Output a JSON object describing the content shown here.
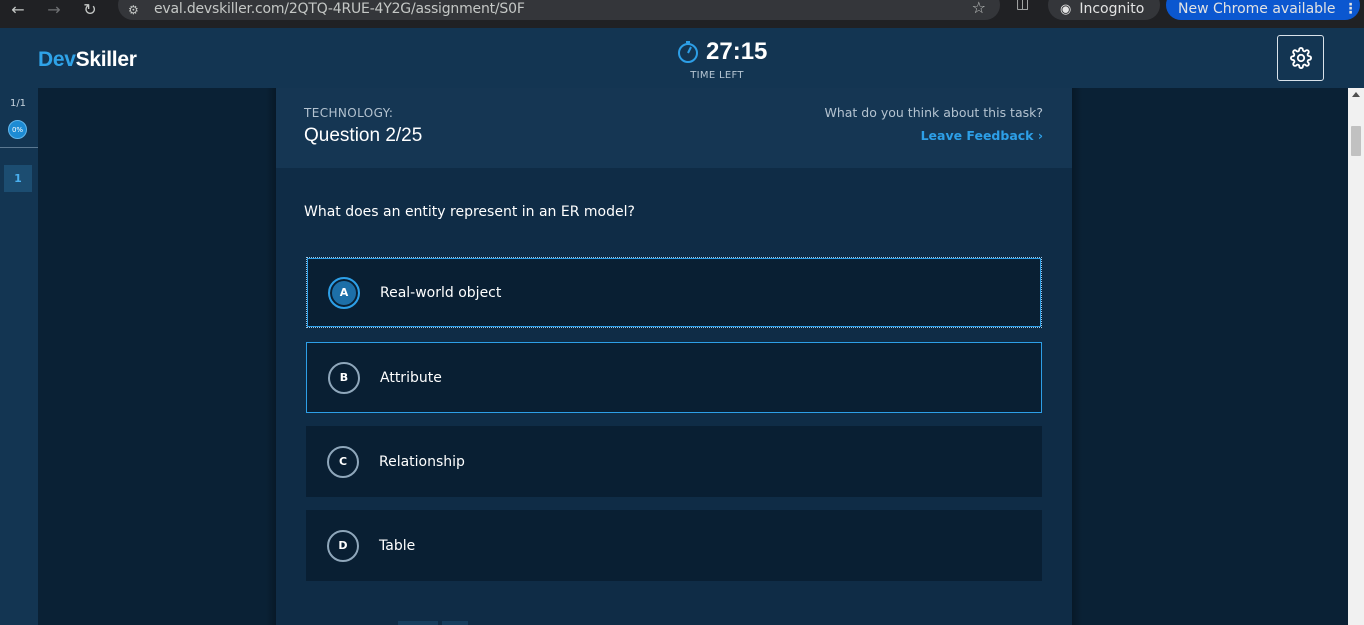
{
  "browser": {
    "url": "eval.devskiller.com/2QTQ-4RUE-4Y2G/assignment/S0F",
    "incognito_label": "Incognito",
    "update_label": "New Chrome available"
  },
  "header": {
    "logo_dev": "Dev",
    "logo_skiller": "Skiller",
    "timer_value": "27:15",
    "timer_label": "TIME LEFT"
  },
  "sidebar": {
    "task_count": "1/1",
    "progress": "0%",
    "task_number": "1"
  },
  "task": {
    "technology_label": "TECHNOLOGY:",
    "question_number": "Question 2/25",
    "feedback_prompt": "What do you think about this task?",
    "feedback_link": "Leave Feedback",
    "question_text": "What does an entity represent in an ER model?",
    "options": [
      {
        "letter": "A",
        "label": "Real-world object"
      },
      {
        "letter": "B",
        "label": "Attribute"
      },
      {
        "letter": "C",
        "label": "Relationship"
      },
      {
        "letter": "D",
        "label": "Table"
      }
    ]
  },
  "colors": {
    "accent": "#2d9fe7",
    "header_bg": "#133552",
    "option_bg": "#091f33"
  }
}
